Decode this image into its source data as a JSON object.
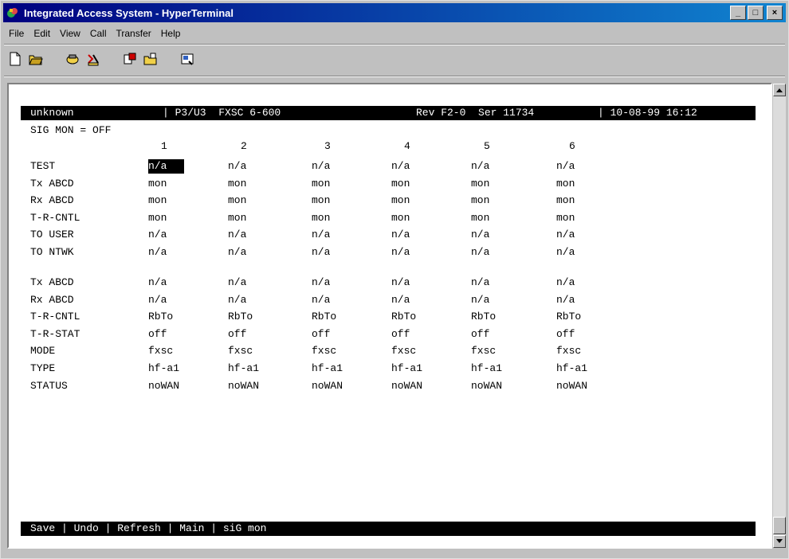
{
  "window": {
    "title": "Integrated Access System - HyperTerminal",
    "min_symbol": "_",
    "max_symbol": "□",
    "close_symbol": "×"
  },
  "menu": [
    "File",
    "Edit",
    "View",
    "Call",
    "Transfer",
    "Help"
  ],
  "toolbar": {
    "buttons": [
      "new-icon",
      "open-icon",
      "disconnect-icon",
      "connect-icon",
      "send-icon",
      "receive-icon",
      "properties-icon"
    ]
  },
  "terminal": {
    "header": {
      "name": "unknown",
      "slot": "| P3/U3  FXSC 6-600",
      "rev": "Rev F2-0  Ser 11734",
      "datetime": "| 10-08-99 16:12"
    },
    "sig_mon": "SIG MON = OFF",
    "columns": [
      "1",
      "2",
      "3",
      "4",
      "5",
      "6"
    ],
    "rows_top": [
      {
        "label": "TEST",
        "values": [
          "n/a",
          "n/a",
          "n/a",
          "n/a",
          "n/a",
          "n/a"
        ]
      },
      {
        "label": "Tx ABCD",
        "values": [
          "mon",
          "mon",
          "mon",
          "mon",
          "mon",
          "mon"
        ]
      },
      {
        "label": "Rx ABCD",
        "values": [
          "mon",
          "mon",
          "mon",
          "mon",
          "mon",
          "mon"
        ]
      },
      {
        "label": "T-R-CNTL",
        "values": [
          "mon",
          "mon",
          "mon",
          "mon",
          "mon",
          "mon"
        ]
      },
      {
        "label": "TO USER",
        "values": [
          "n/a",
          "n/a",
          "n/a",
          "n/a",
          "n/a",
          "n/a"
        ]
      },
      {
        "label": "TO NTWK",
        "values": [
          "n/a",
          "n/a",
          "n/a",
          "n/a",
          "n/a",
          "n/a"
        ]
      }
    ],
    "rows_bottom": [
      {
        "label": "Tx ABCD",
        "values": [
          "n/a",
          "n/a",
          "n/a",
          "n/a",
          "n/a",
          "n/a"
        ]
      },
      {
        "label": "Rx ABCD",
        "values": [
          "n/a",
          "n/a",
          "n/a",
          "n/a",
          "n/a",
          "n/a"
        ]
      },
      {
        "label": "T-R-CNTL",
        "values": [
          "RbTo",
          "RbTo",
          "RbTo",
          "RbTo",
          "RbTo",
          "RbTo"
        ]
      },
      {
        "label": "T-R-STAT",
        "values": [
          "off",
          "off",
          "off",
          "off",
          "off",
          "off"
        ]
      },
      {
        "label": "MODE",
        "values": [
          "fxsc",
          "fxsc",
          "fxsc",
          "fxsc",
          "fxsc",
          "fxsc"
        ]
      },
      {
        "label": "TYPE",
        "values": [
          "hf-a1",
          "hf-a1",
          "hf-a1",
          "hf-a1",
          "hf-a1",
          "hf-a1"
        ]
      },
      {
        "label": "STATUS",
        "values": [
          "noWAN",
          "noWAN",
          "noWAN",
          "noWAN",
          "noWAN",
          "noWAN"
        ]
      }
    ],
    "footer": "Save | Undo | Refresh | Main | siG mon"
  }
}
